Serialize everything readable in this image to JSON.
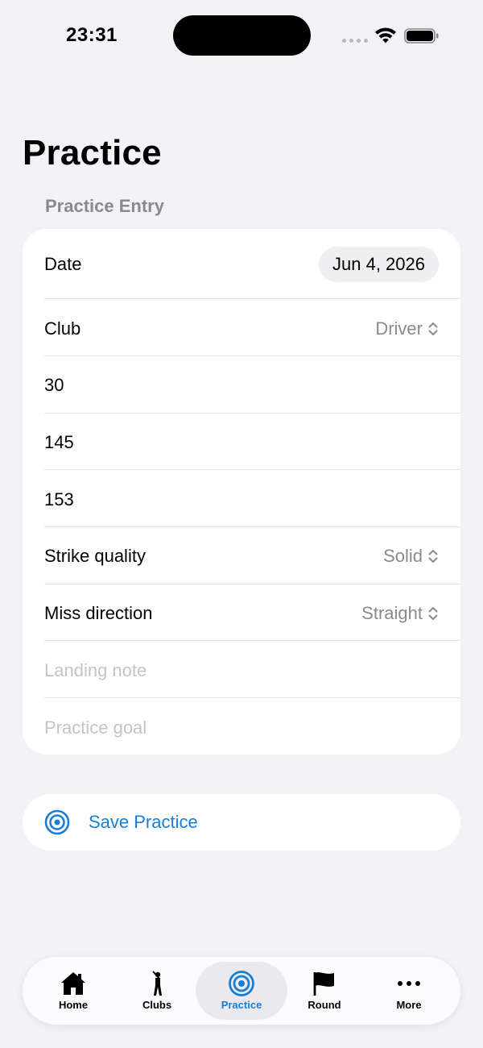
{
  "status_bar": {
    "time": "23:31"
  },
  "page": {
    "title": "Practice",
    "section_header": "Practice Entry"
  },
  "form": {
    "date_label": "Date",
    "date_value": "Jun 4, 2026",
    "club_label": "Club",
    "club_value": "Driver",
    "field_1_value": "30",
    "field_2_value": "145",
    "field_3_value": "153",
    "strike_label": "Strike quality",
    "strike_value": "Solid",
    "miss_label": "Miss direction",
    "miss_value": "Straight",
    "landing_placeholder": "Landing note",
    "goal_placeholder": "Practice goal"
  },
  "save": {
    "label": "Save Practice",
    "icon": "target-icon"
  },
  "tabbar": {
    "tabs": [
      {
        "label": "Home",
        "icon": "house-icon"
      },
      {
        "label": "Clubs",
        "icon": "golfer-icon"
      },
      {
        "label": "Practice",
        "icon": "target-icon"
      },
      {
        "label": "Round",
        "icon": "flag-icon"
      },
      {
        "label": "More",
        "icon": "ellipsis-icon"
      }
    ],
    "active": "Practice"
  },
  "colors": {
    "accent": "#1a7fd4",
    "background": "#f2f2f7",
    "secondary_text": "#8a8a8e",
    "placeholder": "#c4c4c8"
  }
}
